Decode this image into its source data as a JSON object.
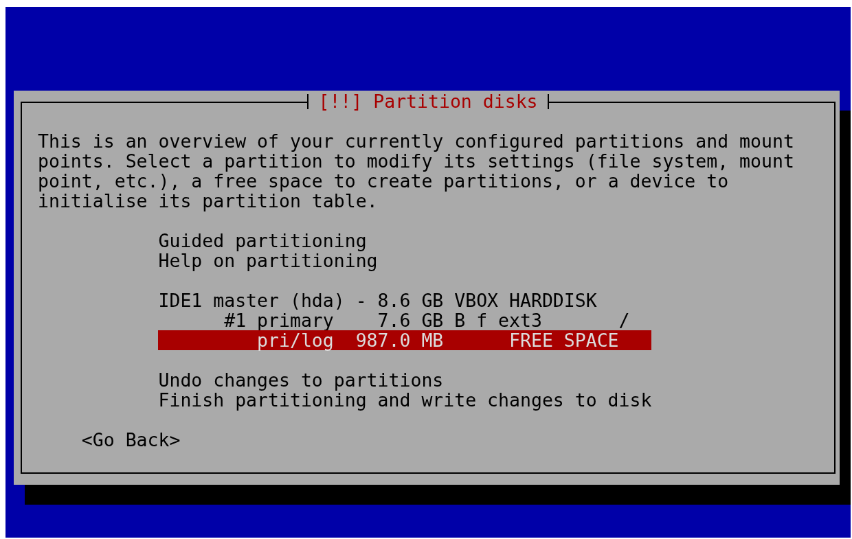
{
  "dialog": {
    "title": "[!!] Partition disks",
    "message": "This is an overview of your currently configured partitions and mount points. Select a partition to modify its settings (file system, mount point, etc.), a free space to create partitions, or a device to initialise its partition table.",
    "menu_groups": [
      [
        {
          "text": "Guided partitioning",
          "selected": false
        },
        {
          "text": "Help on partitioning",
          "selected": false
        }
      ],
      [
        {
          "text": "IDE1 master (hda) - 8.6 GB VBOX HARDDISK",
          "selected": false
        },
        {
          "text": "      #1 primary    7.6 GB B f ext3       /",
          "selected": false
        },
        {
          "text": "         pri/log  987.0 MB      FREE SPACE",
          "selected": true
        }
      ],
      [
        {
          "text": "Undo changes to partitions",
          "selected": false
        },
        {
          "text": "Finish partitioning and write changes to disk",
          "selected": false
        }
      ]
    ],
    "buttons": [
      {
        "label": "<Go Back>",
        "selected": false
      }
    ]
  }
}
